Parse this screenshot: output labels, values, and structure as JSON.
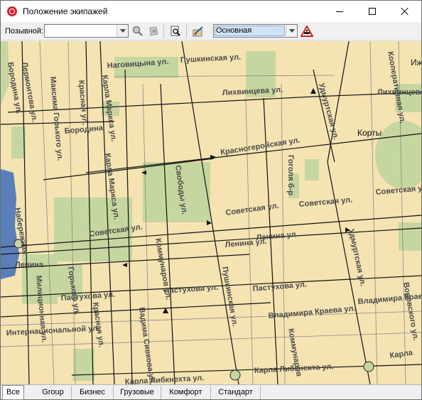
{
  "window": {
    "title": "Положение экипажей"
  },
  "toolbar": {
    "callsign_label": "Позывной:",
    "callsign_value": "",
    "map_style_value": "Основная",
    "icons": [
      "zoom-in-icon",
      "zoom-out-icon",
      "find-page-icon",
      "map-edit-icon",
      "road-warning-icon"
    ]
  },
  "map": {
    "colors": {
      "background": "#f5e3b2",
      "park": "#c6d6a0",
      "water": "#5b7fb9",
      "road": "#000000",
      "label": "#4a4a4a"
    },
    "labels": [
      {
        "id": "nagovitsyna",
        "text": "Наговицына ул."
      },
      {
        "id": "pushkinskaya-top",
        "text": "Пушкинская ул."
      },
      {
        "id": "lihvintseva",
        "text": "Лихвинцева ул."
      },
      {
        "id": "lihvintseva-right",
        "text": "Лихвинцева"
      },
      {
        "id": "udmurtskaya-top",
        "text": "Удмуртская ул."
      },
      {
        "id": "kooperativnaya",
        "text": "Кооперативная ул."
      },
      {
        "id": "izh",
        "text": "Иж"
      },
      {
        "id": "borodina",
        "text": "Бородина"
      },
      {
        "id": "krasnogeroyskaya",
        "text": "Красногеройская ул."
      },
      {
        "id": "korty",
        "text": "Корты"
      },
      {
        "id": "gogolya",
        "text": "Гоголя б-р"
      },
      {
        "id": "karla-marksa",
        "text": "Карла Маркса ул."
      },
      {
        "id": "krasnaya",
        "text": "Красная ул."
      },
      {
        "id": "maksima-gorkogo",
        "text": "Максима Горького ул."
      },
      {
        "id": "karla-marksa-2",
        "text": "Карла Маркса ул."
      },
      {
        "id": "svobody",
        "text": "Свободы ул."
      },
      {
        "id": "sovetskaya-1",
        "text": "Советская ул."
      },
      {
        "id": "sovetskaya-2",
        "text": "Советская ул."
      },
      {
        "id": "sovetskaya-3",
        "text": "Советская ул."
      },
      {
        "id": "sovetskaya-4",
        "text": "Советская ул."
      },
      {
        "id": "lenina-1",
        "text": "Ленина ул."
      },
      {
        "id": "lenina-2",
        "text": "Ленина ул."
      },
      {
        "id": "lenina-3",
        "text": "Ленина"
      },
      {
        "id": "kommunarov",
        "text": "Коммунаров ул."
      },
      {
        "id": "pushkinskaya",
        "text": "Пушкинская ул."
      },
      {
        "id": "udmurtskaya",
        "text": "Удмуртская ул."
      },
      {
        "id": "pastukhova-1",
        "text": "Пастухова ул."
      },
      {
        "id": "pastukhova-2",
        "text": "Пастухова ул."
      },
      {
        "id": "pastukhova-3",
        "text": "Пастухова ул."
      },
      {
        "id": "vladimira-kraeva-1",
        "text": "Владимира Краева ул."
      },
      {
        "id": "vladimira-kraeva-2",
        "text": "Владимира Краева"
      },
      {
        "id": "internatsionalistov",
        "text": "Интернациональной ул."
      },
      {
        "id": "vadima-sivkova",
        "text": "Вадима Сивкова ул."
      },
      {
        "id": "karla-libknekhta-1",
        "text": "Карла Либкнехта ул."
      },
      {
        "id": "karla-libknekhta-2",
        "text": "Карла Либкнехта ул."
      },
      {
        "id": "karla",
        "text": "Карла"
      },
      {
        "id": "bolshevistskaya",
        "text": "Бородина ул."
      },
      {
        "id": "lermontova",
        "text": "Лермонтова ул."
      },
      {
        "id": "gorkogo",
        "text": "Горького ул."
      },
      {
        "id": "krasnaya-2",
        "text": "Красная ул."
      },
      {
        "id": "vorovskogo",
        "text": "Воровского ул."
      },
      {
        "id": "krasnoarmeyskaya",
        "text": "Коммунаров"
      },
      {
        "id": "naberezhnaya",
        "text": "Набережная"
      },
      {
        "id": "oktyabrskaya",
        "text": "Милиционная ул."
      }
    ]
  },
  "tabs": [
    {
      "label": "Все",
      "active": true
    },
    {
      "label": "Group",
      "active": false
    },
    {
      "label": "Бизнес",
      "active": false
    },
    {
      "label": "Грузовые",
      "active": false
    },
    {
      "label": "Комфорт",
      "active": false
    },
    {
      "label": "Стандарт",
      "active": false
    }
  ]
}
